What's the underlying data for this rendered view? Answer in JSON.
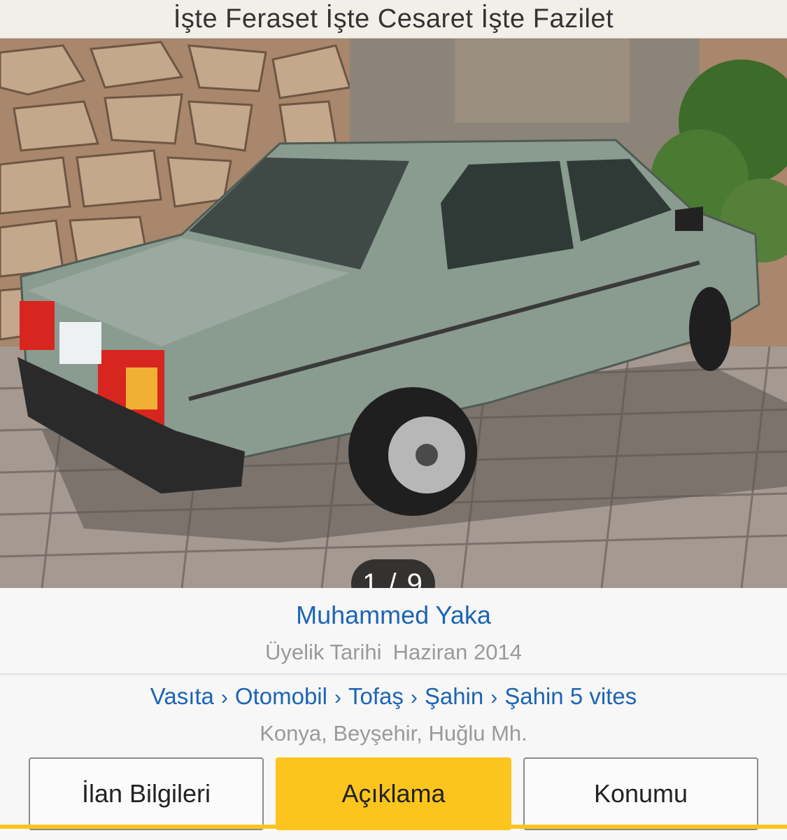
{
  "header": {
    "title": "İşte Feraset İşte Cesaret İşte Fazilet"
  },
  "gallery": {
    "current": "1",
    "separator": "/",
    "total": "9",
    "counter_text": "1 / 9"
  },
  "owner": {
    "name": "Muhammed Yaka",
    "since_label": "Üyelik Tarihi",
    "since_value": "Haziran 2014"
  },
  "breadcrumb": {
    "items": [
      "Vasıta",
      "Otomobil",
      "Tofaş",
      "Şahin",
      "Şahin 5 vites"
    ],
    "separator": "›"
  },
  "location": "Konya, Beyşehir, Huğlu Mh.",
  "tabs": [
    {
      "label": "İlan Bilgileri",
      "active": false
    },
    {
      "label": "Açıklama",
      "active": true
    },
    {
      "label": "Konumu",
      "active": false
    }
  ],
  "colors": {
    "accent": "#fcc51e",
    "link": "#1c64b4",
    "muted": "#9a9a9a"
  }
}
